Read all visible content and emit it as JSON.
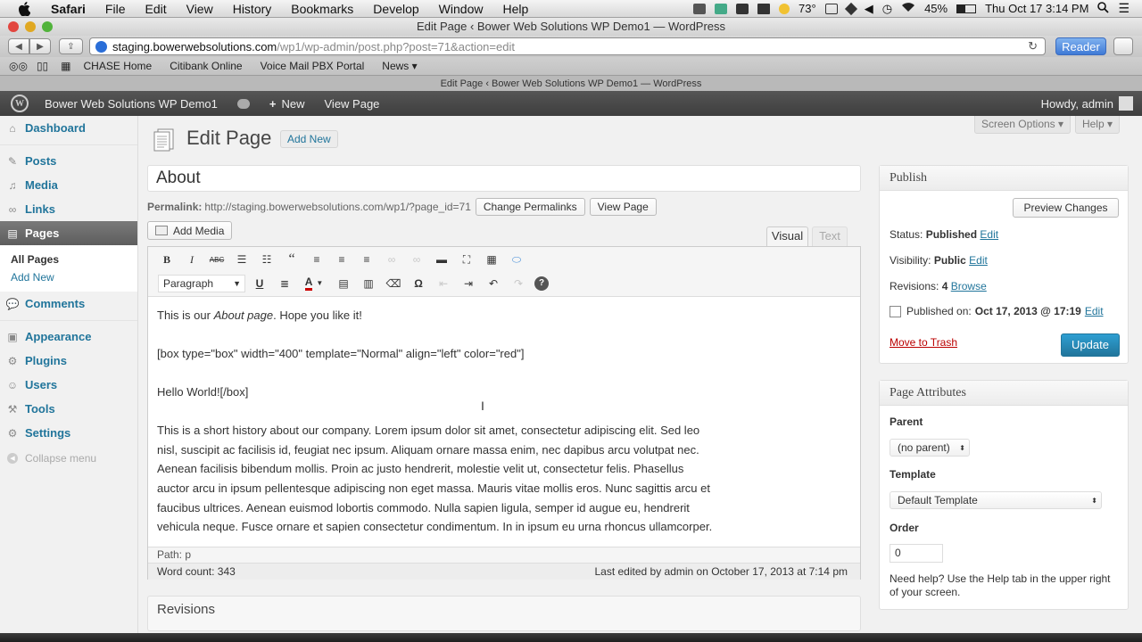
{
  "menubar": {
    "app": "Safari",
    "items": [
      "File",
      "Edit",
      "View",
      "History",
      "Bookmarks",
      "Develop",
      "Window",
      "Help"
    ],
    "temperature": "73°",
    "battery": "45%",
    "datetime": "Thu Oct 17  3:14 PM"
  },
  "window": {
    "title": "Edit Page ‹ Bower Web Solutions WP Demo1 — WordPress",
    "tab_title": "Edit Page ‹ Bower Web Solutions WP Demo1 — WordPress"
  },
  "address": {
    "host": "staging.bowerwebsolutions.com",
    "path": "/wp1/wp-admin/post.php?post=71&action=edit",
    "reader_label": "Reader"
  },
  "bookmarks": [
    "CHASE Home",
    "Citibank Online",
    "Voice Mail PBX Portal",
    "News ▾"
  ],
  "adminbar": {
    "site_name": "Bower Web Solutions WP Demo1",
    "new_label": "New",
    "view_page_label": "View Page",
    "howdy": "Howdy, admin"
  },
  "sidebar": {
    "items": [
      {
        "label": "Dashboard",
        "icon": "dashboard-icon"
      },
      {
        "label": "Posts",
        "icon": "pin-icon"
      },
      {
        "label": "Media",
        "icon": "media-icon"
      },
      {
        "label": "Links",
        "icon": "link-icon"
      },
      {
        "label": "Pages",
        "icon": "pages-icon"
      },
      {
        "label": "Comments",
        "icon": "comment-icon"
      },
      {
        "label": "Appearance",
        "icon": "appearance-icon"
      },
      {
        "label": "Plugins",
        "icon": "plugin-icon"
      },
      {
        "label": "Users",
        "icon": "users-icon"
      },
      {
        "label": "Tools",
        "icon": "tools-icon"
      },
      {
        "label": "Settings",
        "icon": "settings-icon"
      }
    ],
    "sub_all_pages": "All Pages",
    "sub_add_new": "Add New",
    "collapse": "Collapse menu"
  },
  "header": {
    "screen_options": "Screen Options ▾",
    "help": "Help ▾",
    "title": "Edit Page",
    "add_new": "Add New"
  },
  "editor": {
    "post_title": "About",
    "permalink_label": "Permalink:",
    "permalink_url": "http://staging.bowerwebsolutions.com/wp1/?page_id=71",
    "change_permalinks": "Change Permalinks",
    "view_page": "View Page",
    "add_media": "Add Media",
    "tab_visual": "Visual",
    "tab_text": "Text",
    "format": "Paragraph",
    "content_p1_before": "This is our ",
    "content_p1_em": "About page",
    "content_p1_after": ". Hope you like it!",
    "content_p2": "[box type=\"box\" width=\"400\" template=\"Normal\" align=\"left\" color=\"red\"]",
    "content_p3": "Hello World![/box]",
    "content_p4": "This is a short history about our company. Lorem ipsum dolor sit amet, consectetur adipiscing elit. Sed leo nisl, suscipit ac facilisis id, feugiat nec ipsum. Aliquam ornare massa enim, nec dapibus arcu volutpat nec. Aenean facilisis bibendum mollis. Proin ac justo hendrerit, molestie velit ut, consectetur felis. Phasellus auctor arcu in ipsum pellentesque adipiscing non eget massa. Mauris vitae mollis eros. Nunc sagittis arcu et faucibus ultrices. Aenean euismod lobortis commodo. Nulla sapien ligula, semper id augue eu, hendrerit vehicula neque. Fusce ornare et sapien consectetur condimentum. In in ipsum eu urna rhoncus ullamcorper.",
    "path": "Path: p",
    "word_count": "Word count: 343",
    "last_edited": "Last edited by admin on October 17, 2013 at 7:14 pm"
  },
  "revisions_title": "Revisions",
  "publish": {
    "title": "Publish",
    "preview_changes": "Preview Changes",
    "status_label": "Status:",
    "status_value": "Published",
    "visibility_label": "Visibility:",
    "visibility_value": "Public",
    "revisions_label": "Revisions:",
    "revisions_value": "4",
    "browse": "Browse",
    "published_on_label": "Published on:",
    "published_on_value": "Oct 17, 2013 @ 17:19",
    "edit": "Edit",
    "move_to_trash": "Move to Trash",
    "update": "Update"
  },
  "attributes": {
    "title": "Page Attributes",
    "parent_label": "Parent",
    "parent_value": "(no parent)",
    "template_label": "Template",
    "template_value": "Default Template",
    "order_label": "Order",
    "order_value": "0",
    "help_text": "Need help? Use the Help tab in the upper right of your screen."
  },
  "colors": {
    "link": "#21759b",
    "accent_button": "#21759b",
    "trash": "#bb0000"
  }
}
